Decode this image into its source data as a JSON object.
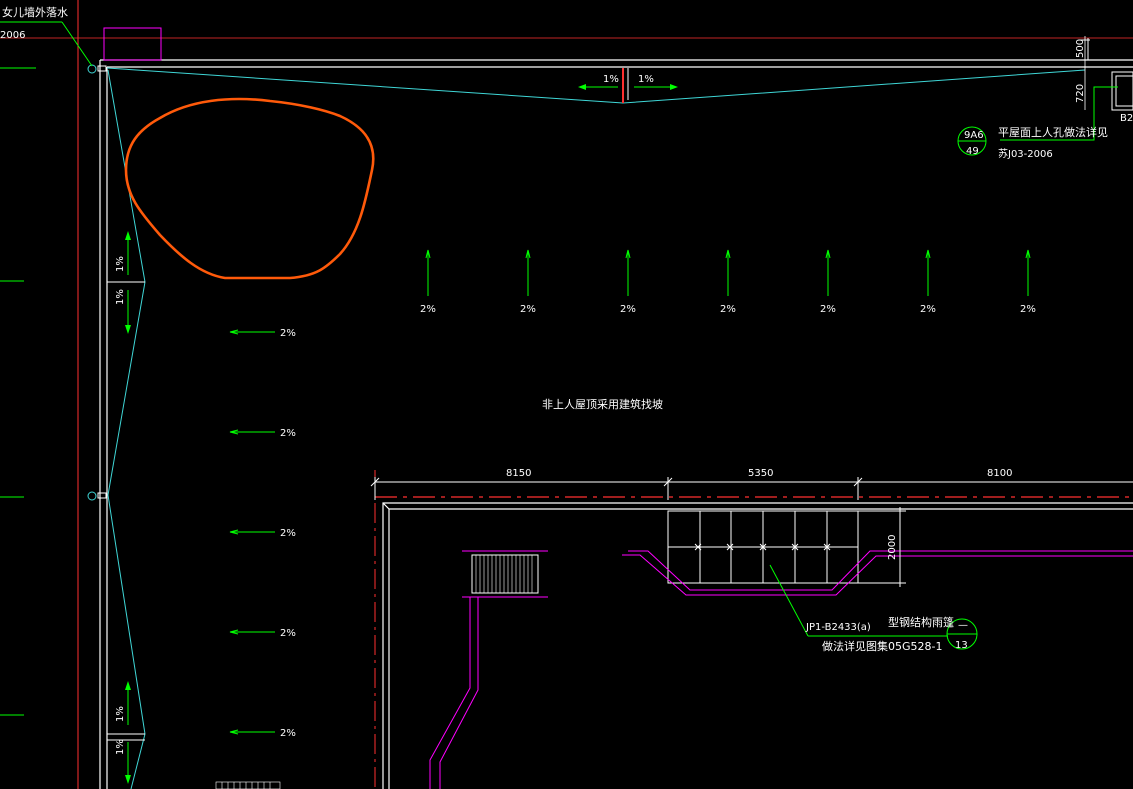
{
  "labels": {
    "parapet_drain": "女儿墙外落水",
    "parapet_ref_year": "2006",
    "hatch_note": "平屋面上人孔做法详见",
    "hatch_ref_std": "苏J03-2006",
    "hatch_symbol_top": "9A6",
    "hatch_symbol_bottom": "49",
    "center_note": "非上人屋顶采用建筑找坡",
    "dim_500": "500",
    "dim_720": "720",
    "dim_8150": "8150",
    "dim_5350": "5350",
    "dim_8100": "8100",
    "dim_2000": "2000",
    "beam_code": "JP1-B2433(a)",
    "beam_note": "型钢结构雨篷",
    "beam_detail_note": "做法详见图集05G528-1",
    "beam_symbol_bottom": "13",
    "beam_symbol_top": "—",
    "edge_tag": "B2"
  },
  "slopes": {
    "top_left": "1%",
    "top_right": "1%",
    "vertical_top": [
      "1%",
      "1%"
    ],
    "vertical_bottom": [
      "1%",
      "1%"
    ],
    "row": [
      "2%",
      "2%",
      "2%",
      "2%",
      "2%",
      "2%",
      "2%"
    ],
    "column": [
      "2%",
      "2%",
      "2%",
      "2%",
      "2%"
    ]
  },
  "colors": {
    "background": "#000000",
    "cyan": "#3fd6d6",
    "green": "#00ff00",
    "magenta": "#ff00ff",
    "red": "#ff3030",
    "white": "#ffffff",
    "orange_markup": "#ff5a0a"
  }
}
